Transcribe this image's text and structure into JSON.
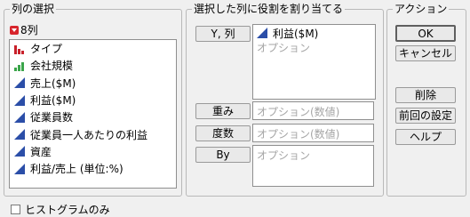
{
  "column_selection": {
    "title": "列の選択",
    "count_label": "8列",
    "columns": [
      {
        "label": "タイプ",
        "icon": "nominal-bar-icon"
      },
      {
        "label": "会社規模",
        "icon": "ordinal-bar-icon"
      },
      {
        "label": "売上($M)",
        "icon": "continuous-triangle-icon"
      },
      {
        "label": "利益($M)",
        "icon": "continuous-triangle-icon"
      },
      {
        "label": "従業員数",
        "icon": "continuous-triangle-icon"
      },
      {
        "label": "従業員一人あたりの利益",
        "icon": "continuous-triangle-icon"
      },
      {
        "label": "資産",
        "icon": "continuous-triangle-icon"
      },
      {
        "label": "利益/売上 (単位:%)",
        "icon": "continuous-triangle-icon"
      }
    ]
  },
  "role_assignment": {
    "title": "選択した列に役割を割り当てる",
    "y_button": "Y, 列",
    "y_assigned": "利益($M)",
    "y_optional": "オプション",
    "weight_button": "重み",
    "weight_placeholder": "オプション(数値)",
    "freq_button": "度数",
    "freq_placeholder": "オプション(数値)",
    "by_button": "By",
    "by_placeholder": "オプション"
  },
  "actions": {
    "title": "アクション",
    "ok": "OK",
    "cancel": "キャンセル",
    "remove": "削除",
    "recall": "前回の設定",
    "help": "ヘルプ"
  },
  "histograms_only": {
    "label": "ヒストグラムのみ",
    "checked": false
  },
  "colors": {
    "nominal_red": "#c8202a",
    "ordinal_green": "#3aa54a",
    "continuous_blue": "#2b4ea8"
  }
}
